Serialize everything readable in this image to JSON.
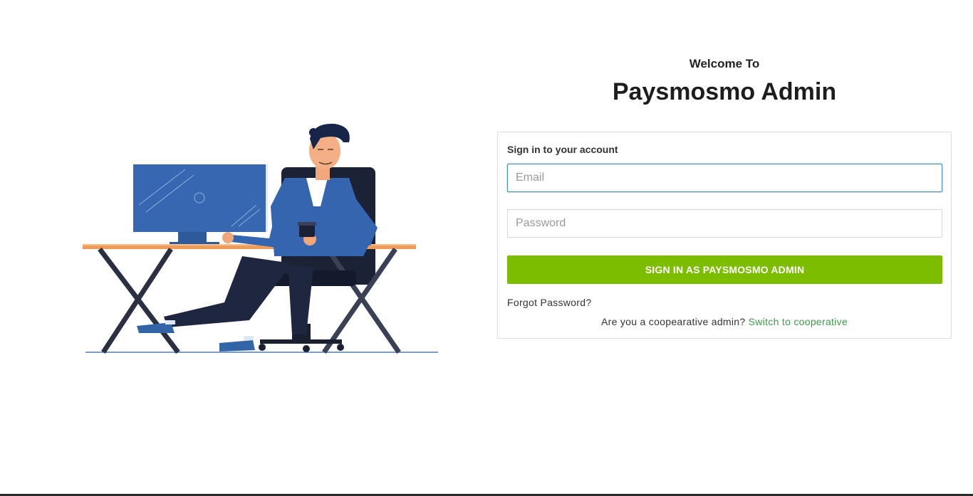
{
  "header": {
    "welcome": "Welcome To",
    "title": "Paysmosmo Admin"
  },
  "form": {
    "heading": "Sign in to your account",
    "email_placeholder": "Email",
    "email_value": "",
    "password_placeholder": "Password",
    "password_value": "",
    "submit_label": "SIGN IN AS PAYSMOSMO ADMIN",
    "forgot_label": "Forgot Password?",
    "switch_prompt": "Are you a coopearative admin?",
    "switch_link": "Switch to cooperative"
  },
  "colors": {
    "primary_button": "#7dbd00",
    "link": "#3c9a4a",
    "focus_border": "#4a8fc4"
  },
  "illustration": {
    "icon": "man-at-desk-illustration"
  }
}
